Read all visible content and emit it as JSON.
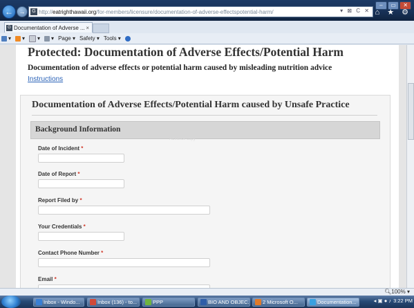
{
  "browser": {
    "url_host": "eatrighthawaii.org",
    "url_path": "/for-members/licensure/documentation-of-adverse-effectspotential-harm/",
    "url_prefix": "http://",
    "tab_title": "Documentation of Adverse ...",
    "tab_close": "×",
    "site_icon": "G",
    "address_tools": "▾ ⊠ C ✕",
    "home_icons": "⌂ ★ ⚙",
    "window_buttons": [
      "‒",
      "▭",
      "✕"
    ]
  },
  "commandbar": {
    "page_label": "Page ▾",
    "safety_label": "Safety ▾",
    "tools_label": "Tools ▾",
    "help_label": "?▾"
  },
  "page": {
    "title": "Protected: Documentation of Adverse Effects/Potential Harm",
    "subtitle": "Documentation of adverse effects or potential harm caused by misleading nutrition advice",
    "instructions_link": "Instructions",
    "form_title": "Documentation of Adverse Effects/Potential Harm caused by Unsafe Practice",
    "section_title": "Background Information",
    "watermark": "Advance copy",
    "required_mark": "*",
    "fields": [
      {
        "label": "Date of Incident",
        "value": ""
      },
      {
        "label": "Date of Report",
        "value": ""
      },
      {
        "label": "Report Filed by",
        "value": ""
      },
      {
        "label": "Your Credentials",
        "value": ""
      },
      {
        "label": "Contact Phone Number",
        "value": ""
      },
      {
        "label": "Email",
        "value": ""
      }
    ]
  },
  "status": {
    "zoom": "100%"
  },
  "taskbar": {
    "items": [
      {
        "label": "Inbox - Windo...",
        "color": "#3a7fd4"
      },
      {
        "label": "Inbox (136) - to...",
        "color": "#d04a3a"
      },
      {
        "label": "PPP",
        "color": "#6fb43f"
      },
      {
        "label": "BIO AND OBJEC...",
        "color": "#2f5ea8"
      },
      {
        "label": "2 Microsoft O...",
        "color": "#e07a2a"
      },
      {
        "label": "Documentation...",
        "color": "#3aa0e0"
      }
    ],
    "clock": "3:22 PM"
  }
}
